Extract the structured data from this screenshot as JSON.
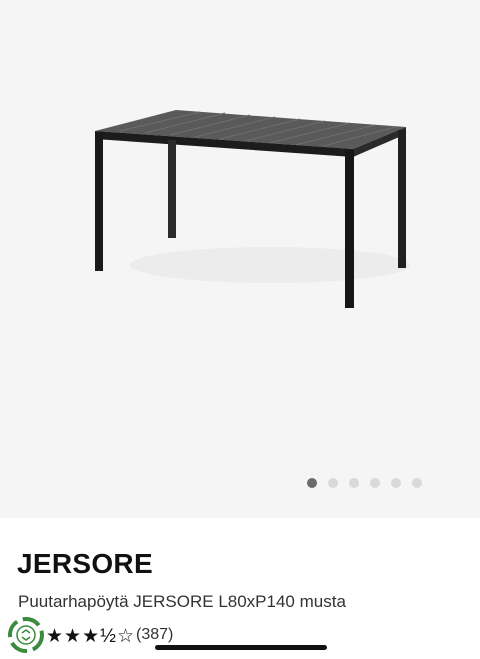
{
  "product": {
    "name": "JERSORE",
    "description": "Puutarhapöytä JERSORE L80xP140 musta",
    "stars_shown": "★★★½☆",
    "rating_value": 3.5,
    "rating_max": 5,
    "review_count": "(387)"
  },
  "gallery": {
    "image_count": 6,
    "active_index": 0,
    "image_subject": "table-icon"
  },
  "colors": {
    "gallery_bg": "#f5f5f5",
    "dot_active": "#6b6b6b",
    "dot_inactive": "#d9d9d9",
    "badge_green": "#3b8a3e"
  }
}
